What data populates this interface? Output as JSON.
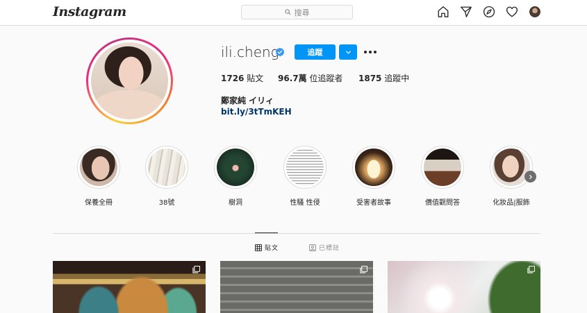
{
  "header": {
    "logo_text": "Instagram",
    "search_placeholder": "搜尋",
    "icons": [
      "home-icon",
      "direct-icon",
      "explore-icon",
      "activity-heart-icon",
      "profile-avatar"
    ]
  },
  "profile": {
    "username": "ili.cheng",
    "verified": true,
    "follow_label": "追蹤",
    "posts_count": "1726",
    "posts_label": "貼文",
    "followers_count": "96.7萬",
    "followers_label": "位追蹤者",
    "following_count": "1875",
    "following_label": "追蹤中",
    "full_name": "鄭家純 イリィ",
    "bio_link": "bit.ly/3tTmKEH"
  },
  "highlights": [
    {
      "label": "保養全冊"
    },
    {
      "label": "38號"
    },
    {
      "label": "樹洞"
    },
    {
      "label": "性騷 性侵"
    },
    {
      "label": "受害者故事"
    },
    {
      "label": "價值觀問答"
    },
    {
      "label": "化妝品|服飾"
    }
  ],
  "tabs": [
    {
      "label": "貼文",
      "active": true
    },
    {
      "label": "已標註",
      "active": false
    }
  ],
  "colors": {
    "accent": "#0095f6",
    "link": "#00376b",
    "border": "#dbdbdb",
    "background": "#fafafa"
  }
}
